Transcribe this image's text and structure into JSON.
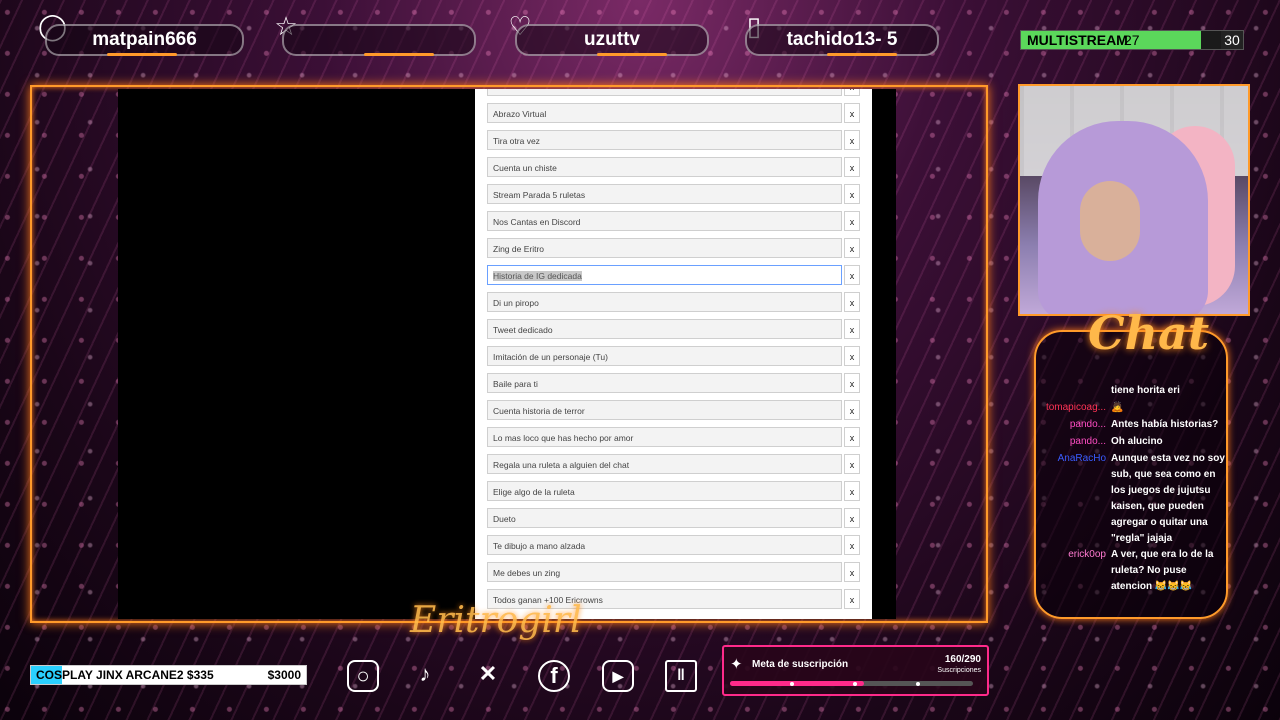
{
  "topbar": {
    "latest_follower": "matpain666",
    "top_donor": "",
    "latest_cheer": "uzuttv",
    "latest_sub": "tachido13- 5",
    "icons": [
      "user-icon",
      "star-icon",
      "heart-icon",
      "ticket-icon"
    ],
    "multistream_label": "MULTISTREAM",
    "multistream_value": "27",
    "multistream_max": "30",
    "multistream_progress": 0.9
  },
  "roulette_items": [
    "Abrazo Virtual",
    "Tira otra vez",
    "Cuenta un chiste",
    "Stream Parada 5 ruletas",
    "Nos Cantas en Discord",
    "Zing de Eritro",
    "Historia de IG dedicada",
    "Di un piropo",
    "Tweet dedicado",
    "Imitación de un personaje (Tu)",
    "Baile para ti",
    "Cuenta historia de terror",
    "Lo mas loco que has hecho por amor",
    "Regala una ruleta a alguien del chat",
    "Elige algo de la ruleta",
    "Dueto",
    "Te dibujo a mano alzada",
    "Me debes un zing",
    "Todos ganan +100 Ericrowns"
  ],
  "remove_label": "x",
  "chat": {
    "title": "Chat",
    "messages": [
      {
        "user": "",
        "color": "#ff4d6d",
        "text": "tiene horita eri"
      },
      {
        "user": "tomapicoag...",
        "color": "#ff3355",
        "text": "🙇"
      },
      {
        "user": "pando...",
        "color": "#ff4dc4",
        "text": "Antes había historias?"
      },
      {
        "user": "pando...",
        "color": "#ff4dc4",
        "text": "Oh alucino"
      },
      {
        "user": "AnaRacHo",
        "color": "#3a5cff",
        "text": "Aunque esta vez no soy sub, que sea como en los juegos de jujutsu kaisen, que pueden agregar o quitar una \"regla\" jajaja"
      },
      {
        "user": "erick0op",
        "color": "#ff7ad0",
        "text": "A ver, que era lo de la ruleta? No puse atencion 😹😹😹"
      }
    ]
  },
  "goal": {
    "label": "COSPLAY JINX ARCANE2 $335",
    "target": "$3000",
    "progress": 0.112
  },
  "socials": [
    "instagram-icon",
    "tiktok-icon",
    "x-icon",
    "facebook-icon",
    "youtube-icon",
    "twitch-icon"
  ],
  "sub_goal": {
    "title": "Meta de suscripción",
    "count": "160/290",
    "caption": "Suscripciones",
    "progress": 0.552
  },
  "signature": "Eritrogirl"
}
